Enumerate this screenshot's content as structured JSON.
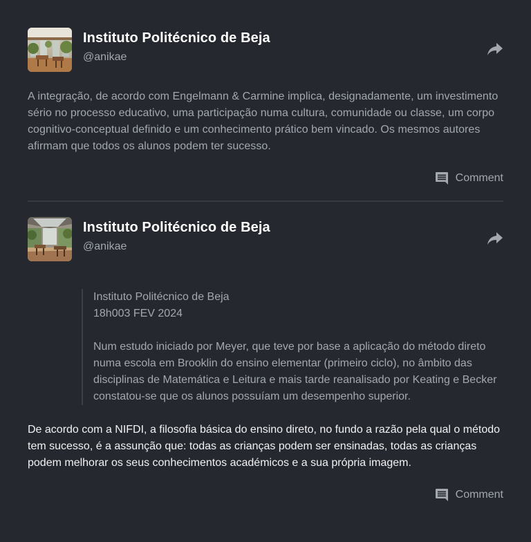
{
  "posts": [
    {
      "display_name": "Instituto Politécnico de Beja",
      "username": "@anikae",
      "body": "A integração, de acordo com Engelmann & Carmine implica, designadamente, um investimento sério no processo educativo, uma participação numa cultura, comunidade ou classe, um corpo cognitivo-conceptual definido e um conhecimento prático bem vincado. Os mesmos autores afirmam que todos os alunos podem ter sucesso.",
      "comment_label": "Comment",
      "share_icon": "share-icon",
      "comment_icon": "comment-icon"
    },
    {
      "display_name": "Instituto Politécnico de Beja",
      "username": "@anikae",
      "quote": {
        "author": "Instituto Politécnico de Beja",
        "date": "18h003 FEV 2024",
        "text": "Num estudo iniciado por Meyer, que teve por base a aplicação do método direto numa escola em Brooklin do ensino elementar (primeiro ciclo), no âmbito das disciplinas de Matemática e Leitura e mais tarde reanalisado por Keating e Becker constatou-se que os alunos possuíam um desempenho superior."
      },
      "body": "De acordo com a NIFDI, a filosofia básica do ensino direto, no fundo a razão pela qual o método tem sucesso, é a assunção que: todas as crianças podem ser ensinadas, todas as crianças podem melhorar os seus conhecimentos académicos e a sua própria imagem.",
      "comment_label": "Comment",
      "share_icon": "share-icon",
      "comment_icon": "comment-icon"
    }
  ],
  "colors": {
    "background": "#25282e",
    "text_primary": "#ffffff",
    "text_secondary": "#a3a8b0",
    "divider": "#363a41"
  }
}
